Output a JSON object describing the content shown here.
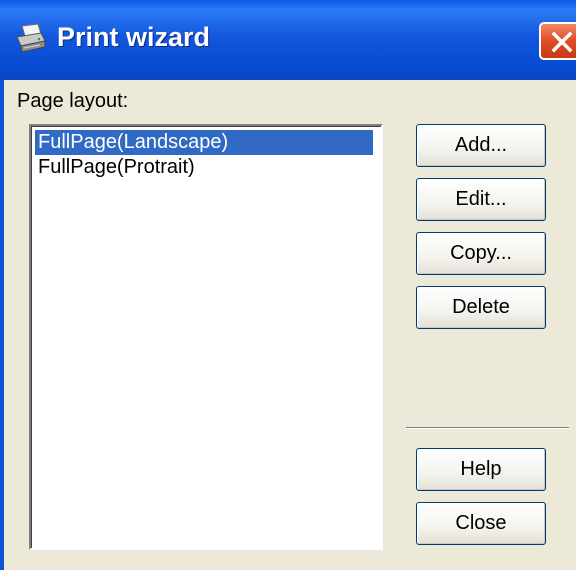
{
  "window": {
    "title": "Print wizard"
  },
  "page_layout": {
    "label": "Page layout:",
    "items": [
      {
        "label": "FullPage(Landscape)",
        "selected": true
      },
      {
        "label": "FullPage(Protrait)",
        "selected": false
      }
    ]
  },
  "buttons": {
    "add": "Add...",
    "edit": "Edit...",
    "copy": "Copy...",
    "delete": "Delete",
    "help": "Help",
    "close": "Close"
  },
  "icons": {
    "title_icon": "printer-icon",
    "close_icon": "close-x-icon"
  },
  "colors": {
    "titlebar": "#0a4ed6",
    "close_button": "#e0512a",
    "selection": "#316ac5",
    "dialog_face": "#ece9d8"
  }
}
